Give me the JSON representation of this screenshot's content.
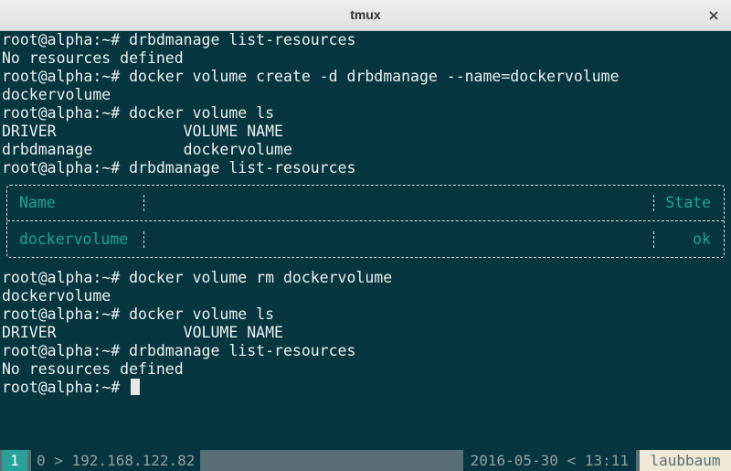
{
  "window": {
    "title": "tmux"
  },
  "terminal": {
    "lines": [
      "root@alpha:~# drbdmanage list-resources",
      "No resources defined",
      "root@alpha:~# docker volume create -d drbdmanage --name=dockervolume",
      "dockervolume",
      "root@alpha:~# docker volume ls",
      "DRIVER              VOLUME NAME",
      "drbdmanage          dockervolume",
      "root@alpha:~# drbdmanage list-resources"
    ],
    "table": {
      "header_name": "Name",
      "header_state": "State",
      "row_name": "dockervolume",
      "row_state": "ok"
    },
    "lines_after": [
      "root@alpha:~# docker volume rm dockervolume",
      "dockervolume",
      "root@alpha:~# docker volume ls",
      "DRIVER              VOLUME NAME",
      "root@alpha:~# drbdmanage list-resources",
      "No resources defined",
      "root@alpha:~# "
    ]
  },
  "statusbar": {
    "window_index": "1",
    "window_label": "0 > 192.168.122.82",
    "datetime": "2016-05-30 < 13:11",
    "hostname": "laubbaum"
  },
  "colors": {
    "terminal_bg": "#073540",
    "table_text": "#1fa596",
    "status_bg": "#586e75"
  }
}
